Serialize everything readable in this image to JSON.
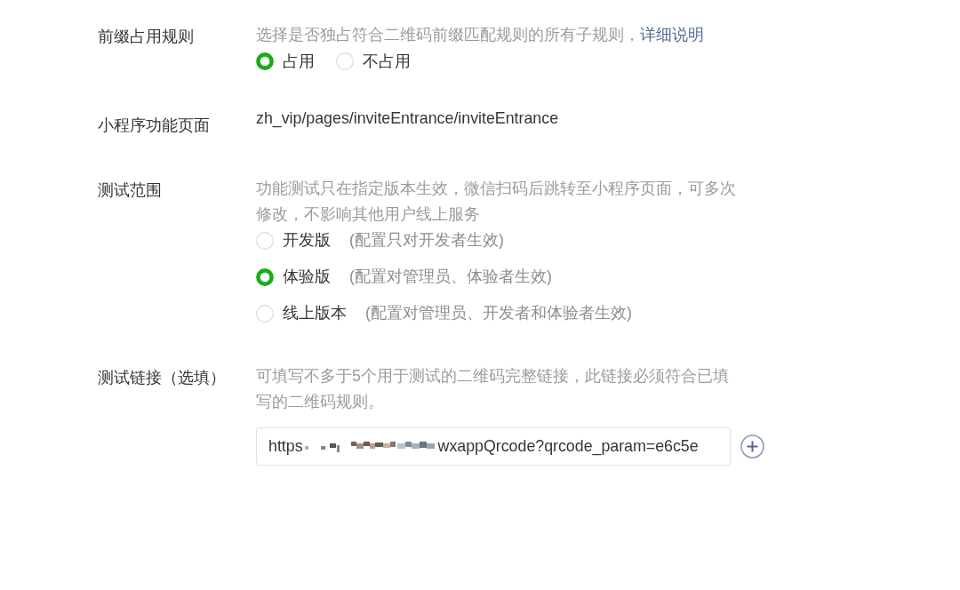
{
  "fields": [
    {
      "kind": "radio",
      "label": "前缀占用规则",
      "description": "选择是否独占符合二维码前缀匹配规则的所有子规则，",
      "link": "详细说明",
      "options": [
        {
          "label": "占用",
          "selected": true
        },
        {
          "label": "不占用",
          "selected": false
        }
      ]
    },
    {
      "kind": "text",
      "label": "小程序功能页面",
      "value": "zh_vip/pages/inviteEntrance/inviteEntrance"
    },
    {
      "kind": "radio_list",
      "label": "测试范围",
      "description": "功能测试只在指定版本生效，微信扫码后跳转至小程序页面，可多次修改，不影响其他用户线上服务",
      "options": [
        {
          "label": "开发版",
          "hint": "(配置只对开发者生效)",
          "selected": false
        },
        {
          "label": "体验版",
          "hint": "(配置对管理员、体验者生效)",
          "selected": true
        },
        {
          "label": "线上版本",
          "hint": "(配置对管理员、开发者和体验者生效)",
          "selected": false
        }
      ]
    },
    {
      "kind": "links",
      "label": "测试链接（选填）",
      "description": "可填写不多于5个用于测试的二维码完整链接，此链接必须符合已填写的二维码规则。",
      "inputs": [
        {
          "value_start": "https",
          "redacted": true,
          "value_end": "wxappQrcode?qrcode_param=e6c5e"
        }
      ]
    }
  ]
}
